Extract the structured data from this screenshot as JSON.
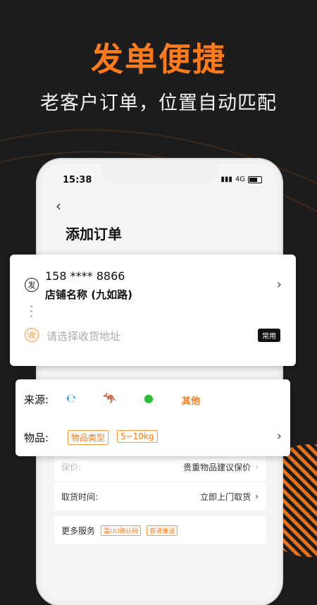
{
  "hero": {
    "title": "发单便捷",
    "subtitle": "老客户订单，位置自动匹配"
  },
  "status": {
    "time": "15:38",
    "network": "4G"
  },
  "page": {
    "back": "‹",
    "title": "添加订单"
  },
  "rows": {
    "insurance_label": "保价:",
    "insurance_hint": "贵重物品建议保价",
    "pickup_label": "取货时间:",
    "pickup_value": "立即上门取货",
    "more_label": "更多服务",
    "more_tag1": "需UU确认码",
    "more_tag2": "普通推送"
  },
  "sender": {
    "icon_char": "发",
    "phone": "158 **** 8866",
    "shop": "店铺名称 (九如路)"
  },
  "receiver": {
    "icon_char": "收",
    "placeholder": "请选择收货地址",
    "common_btn": "常用"
  },
  "source": {
    "label": "来源:",
    "other": "其他"
  },
  "goods": {
    "label": "物品:",
    "type_tag": "物品类型",
    "weight_tag": "5~10kg"
  },
  "colors": {
    "accent": "#ff7a1a",
    "background": "#1c1c1c"
  }
}
